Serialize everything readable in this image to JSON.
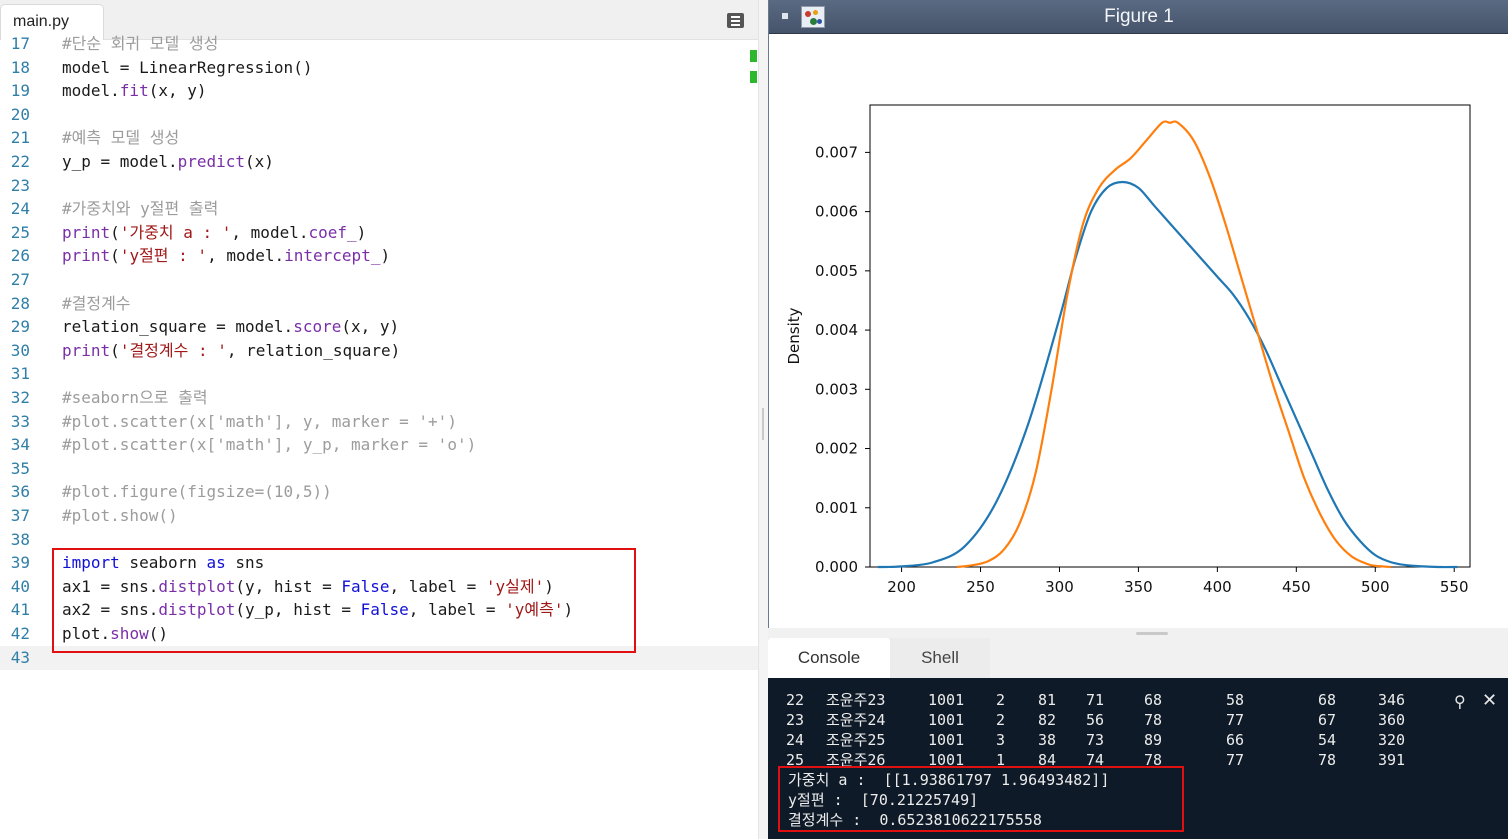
{
  "editor": {
    "tab_title": "main.py",
    "lines": [
      {
        "no": "17",
        "tokens": [
          {
            "t": "#단순 회귀 모델 생성",
            "c": "cm"
          }
        ]
      },
      {
        "no": "18",
        "tokens": [
          {
            "t": "model = LinearRegression()",
            "c": ""
          }
        ]
      },
      {
        "no": "19",
        "tokens": [
          {
            "t": "model.",
            "c": ""
          },
          {
            "t": "fit",
            "c": "fn"
          },
          {
            "t": "(x, y)",
            "c": ""
          }
        ]
      },
      {
        "no": "20",
        "tokens": []
      },
      {
        "no": "21",
        "tokens": [
          {
            "t": "#예측 모델 생성",
            "c": "cm"
          }
        ]
      },
      {
        "no": "22",
        "tokens": [
          {
            "t": "y_p = model.",
            "c": ""
          },
          {
            "t": "predict",
            "c": "fn"
          },
          {
            "t": "(x)",
            "c": ""
          }
        ]
      },
      {
        "no": "23",
        "tokens": []
      },
      {
        "no": "24",
        "tokens": [
          {
            "t": "#가중치와 y절편 출력",
            "c": "cm"
          }
        ]
      },
      {
        "no": "25",
        "tokens": [
          {
            "t": "print",
            "c": "fn"
          },
          {
            "t": "(",
            "c": ""
          },
          {
            "t": "'가중치 a : '",
            "c": "str"
          },
          {
            "t": ", model.",
            "c": ""
          },
          {
            "t": "coef_",
            "c": "fn"
          },
          {
            "t": ")",
            "c": ""
          }
        ]
      },
      {
        "no": "26",
        "tokens": [
          {
            "t": "print",
            "c": "fn"
          },
          {
            "t": "(",
            "c": ""
          },
          {
            "t": "'y절편 : '",
            "c": "str"
          },
          {
            "t": ", model.",
            "c": ""
          },
          {
            "t": "intercept_",
            "c": "fn"
          },
          {
            "t": ")",
            "c": ""
          }
        ]
      },
      {
        "no": "27",
        "tokens": []
      },
      {
        "no": "28",
        "tokens": [
          {
            "t": "#결정계수",
            "c": "cm"
          }
        ]
      },
      {
        "no": "29",
        "tokens": [
          {
            "t": "relation_square = model.",
            "c": ""
          },
          {
            "t": "score",
            "c": "fn"
          },
          {
            "t": "(x, y)",
            "c": ""
          }
        ]
      },
      {
        "no": "30",
        "tokens": [
          {
            "t": "print",
            "c": "fn"
          },
          {
            "t": "(",
            "c": ""
          },
          {
            "t": "'결정계수 : '",
            "c": "str"
          },
          {
            "t": ", relation_square)",
            "c": ""
          }
        ]
      },
      {
        "no": "31",
        "tokens": []
      },
      {
        "no": "32",
        "tokens": [
          {
            "t": "#seaborn으로 출력",
            "c": "cm"
          }
        ]
      },
      {
        "no": "33",
        "tokens": [
          {
            "t": "#plot.scatter(x['math'], y, marker = '+')",
            "c": "cm"
          }
        ]
      },
      {
        "no": "34",
        "tokens": [
          {
            "t": "#plot.scatter(x['math'], y_p, marker = 'o')",
            "c": "cm"
          }
        ]
      },
      {
        "no": "35",
        "tokens": []
      },
      {
        "no": "36",
        "tokens": [
          {
            "t": "#plot.figure(figsize=(10,5))",
            "c": "cm"
          }
        ]
      },
      {
        "no": "37",
        "tokens": [
          {
            "t": "#plot.show()",
            "c": "cm"
          }
        ]
      },
      {
        "no": "38",
        "tokens": []
      },
      {
        "no": "39",
        "tokens": [
          {
            "t": "import",
            "c": "kw"
          },
          {
            "t": " seaborn ",
            "c": ""
          },
          {
            "t": "as",
            "c": "kw"
          },
          {
            "t": " sns",
            "c": ""
          }
        ]
      },
      {
        "no": "40",
        "tokens": [
          {
            "t": "ax1 = sns.",
            "c": ""
          },
          {
            "t": "distplot",
            "c": "fn"
          },
          {
            "t": "(y, hist = ",
            "c": ""
          },
          {
            "t": "False",
            "c": "kw"
          },
          {
            "t": ", label = ",
            "c": ""
          },
          {
            "t": "'y실제'",
            "c": "str"
          },
          {
            "t": ")",
            "c": ""
          }
        ]
      },
      {
        "no": "41",
        "tokens": [
          {
            "t": "ax2 = sns.",
            "c": ""
          },
          {
            "t": "distplot",
            "c": "fn"
          },
          {
            "t": "(y_p, hist = ",
            "c": ""
          },
          {
            "t": "False",
            "c": "kw"
          },
          {
            "t": ", label = ",
            "c": ""
          },
          {
            "t": "'y예측'",
            "c": "str"
          },
          {
            "t": ")",
            "c": ""
          }
        ]
      },
      {
        "no": "42",
        "tokens": [
          {
            "t": "plot.",
            "c": ""
          },
          {
            "t": "show",
            "c": "fn"
          },
          {
            "t": "()",
            "c": ""
          }
        ]
      },
      {
        "no": "43",
        "tokens": []
      }
    ]
  },
  "figure": {
    "title": "Figure 1"
  },
  "chart_data": {
    "type": "line",
    "title": "",
    "xlabel": "",
    "ylabel": "Density",
    "xlim": [
      180,
      560
    ],
    "ylim": [
      0,
      0.0078
    ],
    "x_ticks": [
      "200",
      "250",
      "300",
      "350",
      "400",
      "450",
      "500",
      "550"
    ],
    "y_ticks": [
      "0.000",
      "0.001",
      "0.002",
      "0.003",
      "0.004",
      "0.005",
      "0.006",
      "0.007"
    ],
    "grid": false,
    "series": [
      {
        "color": "#1f77b4",
        "x": [
          185,
          200,
          220,
          240,
          260,
          280,
          300,
          310,
          320,
          330,
          340,
          350,
          360,
          370,
          380,
          390,
          400,
          410,
          420,
          430,
          440,
          450,
          460,
          470,
          480,
          490,
          500,
          510,
          520,
          530,
          540,
          552
        ],
        "y": [
          0.0,
          1e-05,
          8e-05,
          0.00035,
          0.0011,
          0.0024,
          0.0042,
          0.0052,
          0.006,
          0.0064,
          0.0065,
          0.0064,
          0.0061,
          0.0058,
          0.0055,
          0.0052,
          0.0049,
          0.0046,
          0.0042,
          0.0037,
          0.0031,
          0.0025,
          0.0019,
          0.0013,
          0.0008,
          0.00045,
          0.0002,
          8e-05,
          3e-05,
          1e-05,
          0.0,
          0.0
        ]
      },
      {
        "color": "#ff7f0e",
        "x": [
          235,
          245,
          255,
          265,
          275,
          285,
          295,
          305,
          315,
          325,
          335,
          345,
          355,
          365,
          370,
          375,
          385,
          395,
          405,
          415,
          425,
          435,
          445,
          455,
          465,
          475,
          485,
          495,
          500,
          510
        ],
        "y": [
          0.0,
          3e-05,
          0.0001,
          0.0003,
          0.00075,
          0.0016,
          0.003,
          0.0046,
          0.0058,
          0.0064,
          0.0067,
          0.0069,
          0.0072,
          0.0075,
          0.0075,
          0.0075,
          0.0072,
          0.0066,
          0.0058,
          0.0049,
          0.004,
          0.0031,
          0.0023,
          0.0015,
          0.0009,
          0.00045,
          0.00018,
          5e-05,
          2e-05,
          0.0
        ]
      }
    ]
  },
  "console": {
    "tabs": [
      "Console",
      "Shell"
    ],
    "table_rows": [
      [
        "22",
        "조윤주23",
        "1001",
        "2",
        "81",
        "71",
        "68",
        "58",
        "68",
        "346"
      ],
      [
        "23",
        "조윤주24",
        "1001",
        "2",
        "82",
        "56",
        "78",
        "77",
        "67",
        "360"
      ],
      [
        "24",
        "조윤주25",
        "1001",
        "3",
        "38",
        "73",
        "89",
        "66",
        "54",
        "320"
      ],
      [
        "25",
        "조윤주26",
        "1001",
        "1",
        "84",
        "74",
        "78",
        "77",
        "78",
        "391"
      ]
    ],
    "output_lines": [
      "가중치 a :  [[1.93861797 1.96493482]]",
      "y절편 :  [70.21225749]",
      "결정계수 :  0.6523810622175558"
    ],
    "search_glyph": "⚲",
    "close_glyph": "✕"
  }
}
